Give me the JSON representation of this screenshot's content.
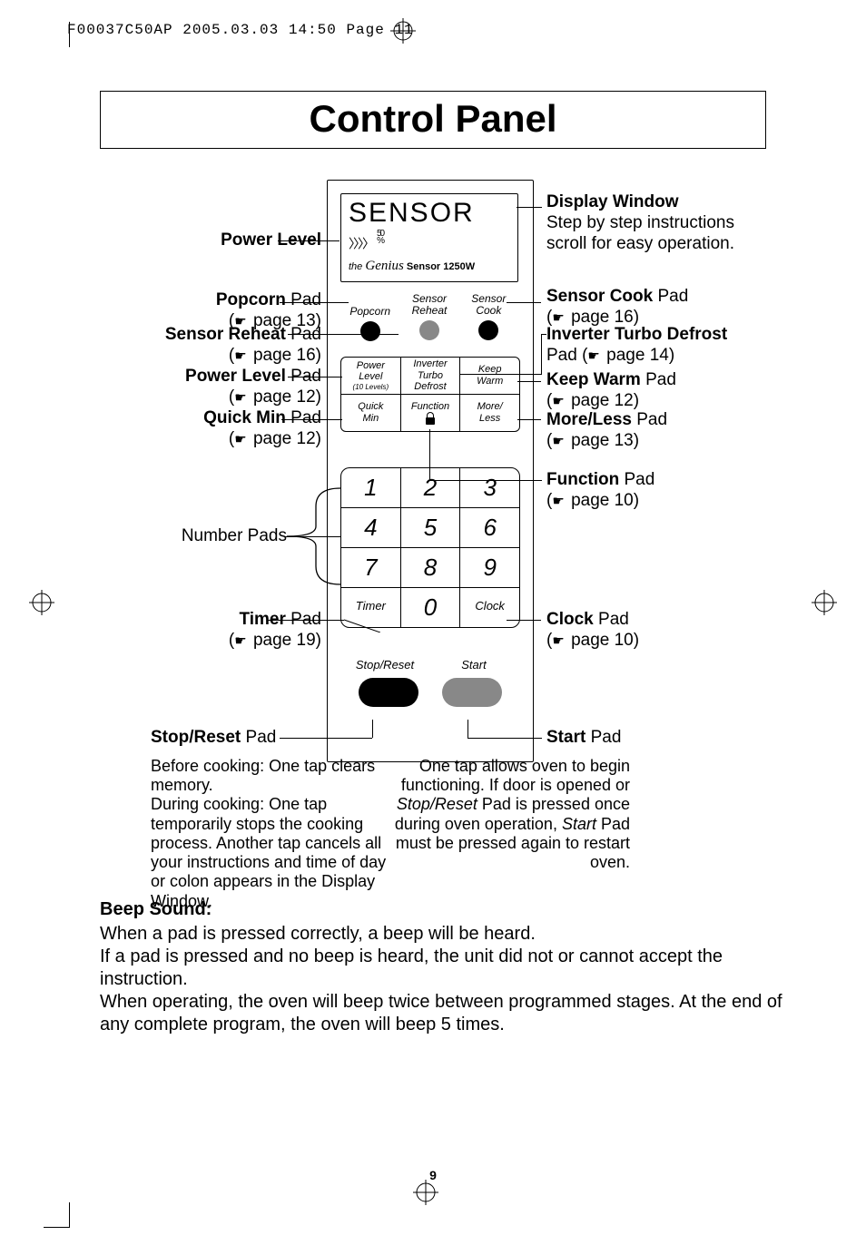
{
  "proof_header": "F00037C50AP  2005.03.03  14:50  Page 11",
  "title": "Control Panel",
  "display": {
    "text": "SENSOR",
    "power_indicator": "50",
    "power_indicator_unit": "%",
    "brand_prefix": "the",
    "brand_script": "Genius",
    "brand_suffix": "Sensor 1250W"
  },
  "sensor_row": {
    "popcorn": "Popcorn",
    "reheat_l1": "Sensor",
    "reheat_l2": "Reheat",
    "cook_l1": "Sensor",
    "cook_l2": "Cook"
  },
  "func_grid": {
    "r1c1_l1": "Power",
    "r1c1_l2": "Level",
    "r1c1_l3": "(10 Levels)",
    "r1c2_l1": "Inverter",
    "r1c2_l2": "Turbo",
    "r1c2_l3": "Defrost",
    "r1c3_l1": "Keep",
    "r1c3_l2": "Warm",
    "r2c1_l1": "Quick",
    "r2c1_l2": "Min",
    "r2c2_l1": "Function",
    "r2c3_l1": "More/",
    "r2c3_l2": "Less"
  },
  "numpad": {
    "n1": "1",
    "n2": "2",
    "n3": "3",
    "n4": "4",
    "n5": "5",
    "n6": "6",
    "n7": "7",
    "n8": "8",
    "n9": "9",
    "timer": "Timer",
    "n0": "0",
    "clock": "Clock"
  },
  "bottom_buttons": {
    "stop": "Stop/Reset",
    "start": "Start"
  },
  "labels": {
    "power_level_ind": "Power Level",
    "popcorn_t": "Popcorn",
    "popcorn_s": " Pad",
    "popcorn_p": "page 13",
    "sensor_reheat_t": "Sensor Reheat",
    "sensor_reheat_s": " Pad",
    "sensor_reheat_p": "page 16",
    "power_level_t": "Power Level",
    "power_level_s": " Pad",
    "power_level_p": "page 12",
    "quick_min_t": "Quick Min",
    "quick_min_s": " Pad",
    "quick_min_p": "page 12",
    "number_pads": "Number Pads",
    "timer_t": "Timer",
    "timer_s": " Pad",
    "timer_p": "page 19",
    "display_t": "Display Window",
    "display_body": "Step by step instructions scroll for easy operation.",
    "sensor_cook_t": "Sensor Cook",
    "sensor_cook_s": " Pad",
    "sensor_cook_p": "page 16",
    "inverter_t": "Inverter Turbo Defrost",
    "inverter_s": "Pad (",
    "inverter_p": "page 14",
    "inverter_close": ")",
    "keep_warm_t": "Keep Warm",
    "keep_warm_s": " Pad",
    "keep_warm_p": "page 12",
    "more_less_t": "More/Less",
    "more_less_s": " Pad",
    "more_less_p": "page 13",
    "function_t": "Function",
    "function_s": " Pad",
    "function_p": "page 10",
    "clock_t": "Clock",
    "clock_s": " Pad",
    "clock_p": "page 10",
    "start_t": "Start",
    "start_s": " Pad",
    "stop_t": "Stop/Reset",
    "stop_s": " Pad"
  },
  "stop_reset_expl": {
    "l1b": "Before cooking:",
    "l1": " One tap clears memory.",
    "l2b": "During cooking:",
    "l2": " One tap temporarily stops the cooking process. Another tap cancels all your instructions and time of day or colon appears in the ",
    "l3b": "Display Window",
    "l3": "."
  },
  "start_expl": {
    "t1": "One tap allows oven to begin functioning. If door is opened or ",
    "t2b": "Stop/Reset",
    "t3": " Pad is pressed once during oven operation, ",
    "t4b": "Start",
    "t5": " Pad must be pressed again to restart oven."
  },
  "beep": {
    "heading": "Beep Sound:",
    "body": "When a pad is pressed correctly, a beep will be heard.\nIf a pad is pressed and no beep is heard, the unit did not or cannot accept the instruction.\nWhen operating, the oven will beep twice between programmed stages. At the end of any complete program, the oven will beep 5 times."
  },
  "page_number": "9"
}
